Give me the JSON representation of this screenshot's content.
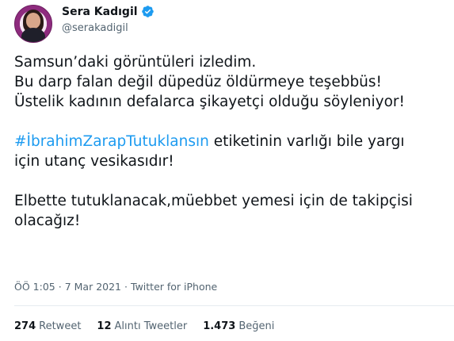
{
  "author": {
    "display_name": "Sera Kadıgil",
    "handle": "@serakadigil",
    "verified_icon": "verified-badge-icon"
  },
  "tweet": {
    "lines_block1": [
      "Samsun’daki görüntüleri izledim.",
      "Bu darp falan değil düpedüz öldürmeye teşebbüs!",
      "Üstelik kadının defalarca şikayetçi olduğu söyleniyor!"
    ],
    "hashtag": "#İbrahimZarapTutuklansın",
    "hashtag_rest": " etiketinin varlığı bile yargı",
    "line_block2_2": "için utanç vesikasıdır!",
    "lines_block3": [
      "Elbette tutuklanacak,müebbet yemesi için de takipçisi",
      "olacağız!"
    ]
  },
  "meta": {
    "time": "ÖÖ 1:05",
    "separator": "·",
    "date": "7 Mar 2021",
    "source": "Twitter for iPhone"
  },
  "stats": {
    "retweets_count": "274",
    "retweets_label": "Retweet",
    "quotes_count": "12",
    "quotes_label": "Alıntı Tweetler",
    "likes_count": "1.473",
    "likes_label": "Beğeni"
  },
  "colors": {
    "link": "#1d9bf0",
    "verified": "#1d9bf0",
    "text": "#0f1419",
    "muted": "#536471"
  }
}
